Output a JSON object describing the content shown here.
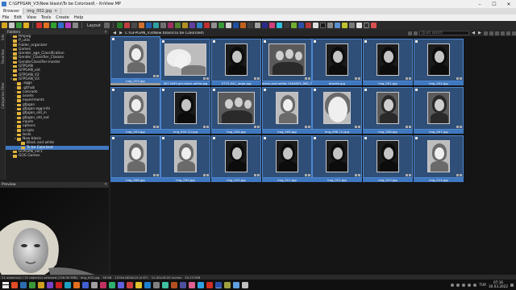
{
  "window": {
    "title": "C:\\GFPGAN_V3\\New blasis\\To be Colorized\\ - XnView MP",
    "controls": [
      "–",
      "☐",
      "✕"
    ]
  },
  "tabs": [
    {
      "label": "Browser",
      "active": true
    },
    {
      "label": "img_002.jpg",
      "active": false
    }
  ],
  "menu": [
    "File",
    "Edit",
    "View",
    "Tools",
    "Create",
    "Help"
  ],
  "toolbar": {
    "layout_label": "Layout"
  },
  "side_tabs": [
    "Info",
    "Favorites",
    "Categories Filter"
  ],
  "folders_panel": {
    "title": "Folders",
    "items": [
      {
        "label": "ffmpeg",
        "depth": 1,
        "expanded": false,
        "selected": false
      },
      {
        "label": "ff_utils",
        "depth": 1,
        "expanded": false,
        "selected": false
      },
      {
        "label": "Folder_organizer",
        "depth": 1,
        "expanded": false,
        "selected": false
      },
      {
        "label": "Games",
        "depth": 1,
        "expanded": false,
        "selected": false
      },
      {
        "label": "Gender_age_Classification",
        "depth": 1,
        "expanded": false,
        "selected": false
      },
      {
        "label": "Gender_Classifier_Classes",
        "depth": 1,
        "expanded": false,
        "selected": false
      },
      {
        "label": "GenderClassifier-master",
        "depth": 1,
        "expanded": false,
        "selected": false
      },
      {
        "label": "GFPGAN",
        "depth": 1,
        "expanded": false,
        "selected": false
      },
      {
        "label": "GFPGAN_old",
        "depth": 1,
        "expanded": false,
        "selected": false
      },
      {
        "label": "GFPGAN_V2",
        "depth": 1,
        "expanded": false,
        "selected": false
      },
      {
        "label": "GFPGAN_V3",
        "depth": 1,
        "expanded": true,
        "selected": false
      },
      {
        "label": ".eggs",
        "depth": 2,
        "expanded": false,
        "selected": false
      },
      {
        "label": ".github",
        "depth": 2,
        "expanded": false,
        "selected": false
      },
      {
        "label": "colorado",
        "depth": 2,
        "expanded": false,
        "selected": false
      },
      {
        "label": "assets",
        "depth": 2,
        "expanded": false,
        "selected": false
      },
      {
        "label": "experiments",
        "depth": 2,
        "expanded": false,
        "selected": false
      },
      {
        "label": "gfpgan",
        "depth": 2,
        "expanded": false,
        "selected": false
      },
      {
        "label": "gfpgan.egg-info",
        "depth": 2,
        "expanded": false,
        "selected": false
      },
      {
        "label": "gfpgan_old_in",
        "depth": 2,
        "expanded": false,
        "selected": false
      },
      {
        "label": "gfpgan_old_out",
        "depth": 2,
        "expanded": false,
        "selected": false
      },
      {
        "label": "inputs",
        "depth": 2,
        "expanded": false,
        "selected": false
      },
      {
        "label": "options",
        "depth": 2,
        "expanded": false,
        "selected": false
      },
      {
        "label": "scripts",
        "depth": 2,
        "expanded": false,
        "selected": false
      },
      {
        "label": "tests",
        "depth": 2,
        "expanded": false,
        "selected": false
      },
      {
        "label": "New blasis",
        "depth": 2,
        "expanded": true,
        "selected": false
      },
      {
        "label": "Black and white",
        "depth": 3,
        "expanded": false,
        "selected": false
      },
      {
        "label": "To be Colorized",
        "depth": 3,
        "expanded": false,
        "selected": true
      },
      {
        "label": "GFPGAN_ver1",
        "depth": 1,
        "expanded": false,
        "selected": false
      },
      {
        "label": "GOG Games",
        "depth": 1,
        "expanded": false,
        "selected": false
      }
    ]
  },
  "preview_panel": {
    "title": "Preview",
    "rating_stars": 5
  },
  "browser": {
    "path": "C:\\GFPGAN_V3\\New blasis\\To be Colorized\\",
    "search_placeholder": "Quick search",
    "thumbnails": [
      {
        "caption": "",
        "kind": "up-folder",
        "selected": false
      },
      {
        "caption": "4K11609-girl-black-white.jpg",
        "selected": true,
        "tone": "light",
        "pose": "reclining"
      },
      {
        "caption": "5773-541_large.jpg",
        "selected": true,
        "tone": "dark",
        "pose": "portrait"
      },
      {
        "caption": "black-and-white-1464603_960_720.jpg",
        "selected": true,
        "tone": "mid",
        "pose": "group"
      },
      {
        "caption": "blonde.jpg",
        "selected": true,
        "tone": "dark",
        "pose": "portrait"
      },
      {
        "caption": "img_001.jpg",
        "selected": true,
        "tone": "dark",
        "pose": "portrait"
      },
      {
        "caption": "img_002.jpg",
        "selected": true,
        "tone": "dark",
        "pose": "portrait"
      },
      {
        "caption": "img_003.jpg",
        "selected": true,
        "tone": "light",
        "pose": "portrait"
      },
      {
        "caption": "img_004 (1).jpg",
        "selected": true,
        "tone": "dark",
        "pose": "portrait"
      },
      {
        "caption": "img_004.jpg",
        "selected": true,
        "tone": "mid",
        "pose": "group"
      },
      {
        "caption": "img_005.jpg",
        "selected": true,
        "tone": "light",
        "pose": "portrait"
      },
      {
        "caption": "img_006 (1).jpg",
        "selected": true,
        "tone": "light",
        "pose": "closeup"
      },
      {
        "caption": "img_006.jpg",
        "selected": true,
        "tone": "mid",
        "pose": "portrait"
      },
      {
        "caption": "img_007.jpg",
        "selected": true,
        "tone": "mid",
        "pose": "portrait"
      },
      {
        "caption": "img_008.jpg",
        "selected": true,
        "tone": "light",
        "pose": "portrait"
      },
      {
        "caption": "img_009.jpg",
        "selected": true,
        "tone": "light",
        "pose": "portrait"
      },
      {
        "caption": "img_010.jpg",
        "selected": true,
        "tone": "dark",
        "pose": "portrait"
      },
      {
        "caption": "img_011.jpg",
        "selected": true,
        "tone": "dark",
        "pose": "portrait"
      },
      {
        "caption": "img_012.jpg",
        "selected": true,
        "tone": "dark",
        "pose": "portrait"
      },
      {
        "caption": "img_013.jpg",
        "selected": true,
        "tone": "dark",
        "pose": "portrait"
      },
      {
        "caption": "img_014.jpg",
        "selected": true,
        "tone": "light",
        "pose": "portrait"
      },
      {
        "caption": "img_015.jpg",
        "selected": true,
        "tone": "light",
        "pose": "portrait"
      }
    ]
  },
  "statusbar": [
    "21 objects(s) / 21 object(s) selected [126.90 MiB]",
    "img_002.jpg",
    "36 KB",
    "1200x1800x24 (0.67)",
    "12.00x18.00 inches",
    "30.23 MiB"
  ],
  "taskbar": {
    "lang": "TUR",
    "time": "07:16",
    "date": "30.03.2022",
    "apps": [
      "#e34c26",
      "#2b6cb0",
      "#3a9a3a",
      "#d0a020",
      "#7a42c4",
      "#c82020",
      "#20a0c0",
      "#e07020",
      "#4060d0",
      "#a0a0a0",
      "#c03060",
      "#30b070",
      "#6060e0",
      "#d04040",
      "#e0c030",
      "#2080d0",
      "#808080",
      "#40c0a0",
      "#b05020",
      "#5050a0",
      "#e06090",
      "#30a0e0",
      "#d03020",
      "#2d4fa8",
      "#a0a040",
      "#60a0e0",
      "#c0c0c0"
    ]
  },
  "colors": {
    "accent": "#3f78c0",
    "folder": "#e2b23c",
    "background": "#1e1e1e"
  }
}
